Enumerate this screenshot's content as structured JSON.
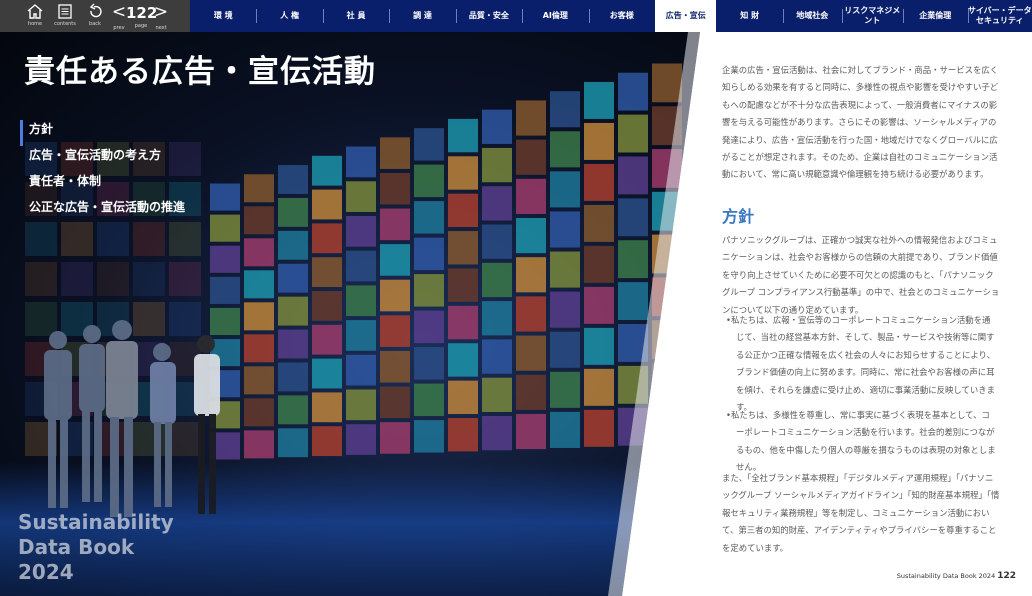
{
  "toolbar": {
    "home_label": "home",
    "contents_label": "contents",
    "back_label": "back",
    "prev_label": "prev",
    "page_label": "page",
    "next_label": "next",
    "page_number": "122",
    "prev_glyph": "<",
    "next_glyph": ">"
  },
  "nav": [
    {
      "label": "環 境",
      "active": false
    },
    {
      "label": "人 権",
      "active": false
    },
    {
      "label": "社 員",
      "active": false
    },
    {
      "label": "調 達",
      "active": false
    },
    {
      "label": "品質・安全",
      "active": false
    },
    {
      "label": "AI倫理",
      "active": false
    },
    {
      "label": "お客様",
      "active": false
    },
    {
      "label": "広告・宣伝",
      "active": true
    },
    {
      "label": "知 財",
      "active": false
    },
    {
      "label": "地域社会",
      "active": false
    },
    {
      "label": "リスクマネジメント",
      "active": false
    },
    {
      "label": "企業倫理",
      "active": false
    },
    {
      "label": "サイバー・データ\nセキュリティ",
      "active": false
    }
  ],
  "page": {
    "title": "責任ある広告・宣伝活動",
    "toc": [
      {
        "label": "方針",
        "active": true
      },
      {
        "label": "広告・宣伝活動の考え方",
        "active": false
      },
      {
        "label": "責任者・体制",
        "active": false
      },
      {
        "label": "公正な広告・宣伝活動の推進",
        "active": false
      }
    ],
    "book_title_line1": "Sustainability",
    "book_title_line2": "Data Book",
    "book_title_line3": "2024"
  },
  "content": {
    "intro": "企業の広告・宣伝活動は、社会に対してブランド・商品・サービスを広く知らしめる効果を有すると同時に、多様性の視点や影響を受けやすい子どもへの配慮などが不十分な広告表現によって、一般消費者にマイナスの影響を与える可能性があります。さらにその影響は、ソーシャルメディアの発達により、広告・宣伝活動を行った国・地域だけでなくグローバルに広がることが想定されます。そのため、企業は自社のコミュニケーション活動において、常に高い規範意識や倫理観を持ち続ける必要があります。",
    "policy_heading": "方針",
    "policy_text": "パナソニックグループは、正確かつ誠実な社外への情報発信およびコミュニケーションは、社会やお客様からの信頼の大前提であり、ブランド価値を守り向上させていくために必要不可欠との認識のもと、「パナソニックグループ コンプライアンス行動基準」の中で、社会とのコミュニケーションについて以下の通り定めています。",
    "bullets": [
      "•私たちは、広報・宣伝等のコーポレートコミュニケーション活動を通じて、当社の経営基本方針、そして、製品・サービスや技術等に関する公正かつ正確な情報を広く社会の人々にお知らせすることにより、ブランド価値の向上に努めます。同時に、常に社会やお客様の声に耳を傾け、それらを謙虚に受け止め、適切に事業活動に反映していきます。",
      "•私たちは、多様性を尊重し、常に事実に基づく表現を基本として、コーポレートコミュニケーション活動を行います。社会的差別につながるもの、他を中傷したり個人の尊厳を損なうものは表現の対象としません。"
    ],
    "closing": "また、「全社ブランド基本規程」「デジタルメディア運用規程」「パナソニックグループ ソーシャルメディアガイドライン」「知的財産基本規程」「情報セキュリティ業務規程」等を制定し、コミュニケーション活動において、第三者の知的財産、アイデンティティやプライバシーを尊重することを定めています。"
  },
  "footer": {
    "book": "Sustainability Data Book 2024",
    "page": "122"
  },
  "colors": {
    "nav_bg": "#0a1f6b",
    "toolbar_bg": "#3d3d3d",
    "accent_blue": "#3a78c2",
    "body_text": "#5a5a5a"
  }
}
